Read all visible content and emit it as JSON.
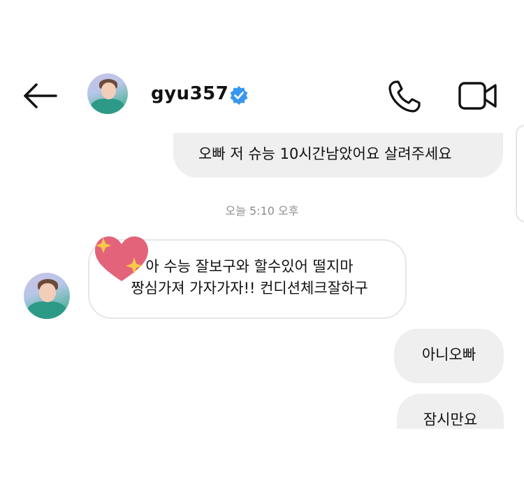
{
  "header": {
    "back_icon": "arrow-left-icon",
    "username": "gyu357",
    "verified_icon": "verified-badge-icon",
    "call_icon": "phone-icon",
    "video_icon": "video-camera-icon"
  },
  "messages": [
    {
      "direction": "sent",
      "text": "오빠 저 슈능 10시간남았어요 살려주세요"
    },
    {
      "direction": "received",
      "line1": "아 수능 잘보구와 할수있어 떨지마",
      "line2": "짱심가져 가자가자!! 컨디션체크잘하구",
      "sticker": "sparkle-heart-icon"
    },
    {
      "direction": "sent",
      "text": "아니오빠"
    },
    {
      "direction": "sent",
      "text": "잠시만요"
    }
  ],
  "timestamp": "오늘 5:10 오후",
  "colors": {
    "sent_bubble": "#efefef",
    "received_border": "#e6e6e6",
    "verified_blue": "#3897f0",
    "heart_pink": "#e3647a",
    "sparkle_yellow": "#f7c948",
    "timestamp_gray": "#8e8e8e"
  }
}
